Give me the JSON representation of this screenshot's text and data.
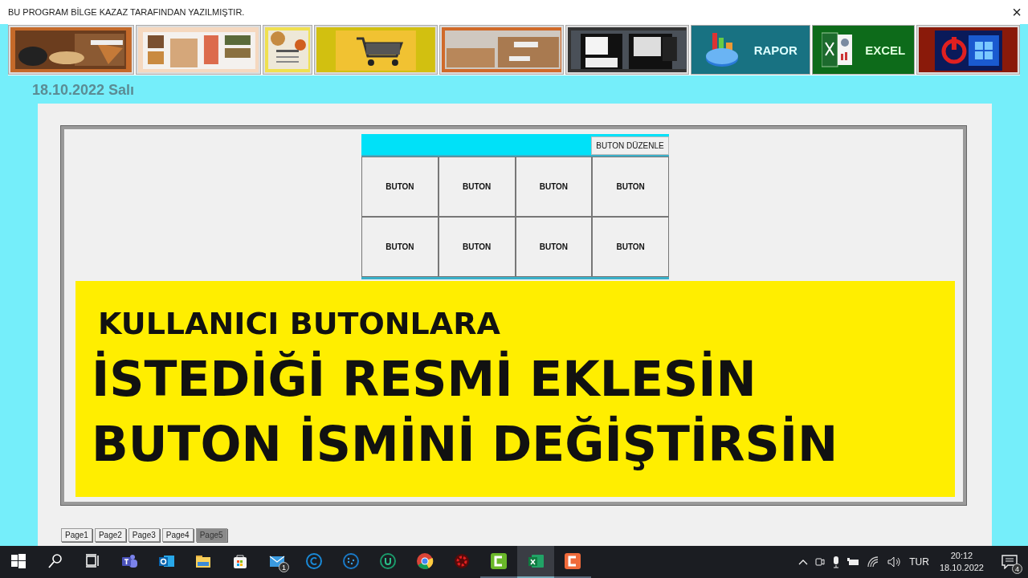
{
  "window": {
    "title": "BU PROGRAM BİLGE KAZAZ TARAFINDAN YAZILMIŞTIR.",
    "close": "×"
  },
  "toolbar": [
    {
      "kind": "picture"
    },
    {
      "kind": "picture"
    },
    {
      "kind": "picture"
    },
    {
      "kind": "picture"
    },
    {
      "kind": "picture"
    },
    {
      "kind": "picture"
    },
    {
      "kind": "report",
      "label": "RAPOR"
    },
    {
      "kind": "excel",
      "label": "EXCEL"
    },
    {
      "kind": "picture"
    }
  ],
  "date": "18.10.2022 Salı",
  "panel": {
    "edit_button": "BUTON DÜZENLE",
    "buttons": [
      "BUTON",
      "BUTON",
      "BUTON",
      "BUTON",
      "BUTON",
      "BUTON",
      "BUTON",
      "BUTON"
    ],
    "banner": [
      "KULLANICI BUTONLARA",
      "İSTEDİĞİ RESMİ EKLESİN",
      "BUTON İSMİNİ DEĞİŞTİRSİN"
    ]
  },
  "tabs": [
    {
      "label": "Page1",
      "selected": false
    },
    {
      "label": "Page2",
      "selected": false
    },
    {
      "label": "Page3",
      "selected": false
    },
    {
      "label": "Page4",
      "selected": false
    },
    {
      "label": "Page5",
      "selected": true
    }
  ],
  "taskbar": {
    "apps": [
      {
        "kind": "start"
      },
      {
        "kind": "search"
      },
      {
        "kind": "taskview"
      },
      {
        "kind": "teams"
      },
      {
        "kind": "outlook"
      },
      {
        "kind": "folder"
      },
      {
        "kind": "store"
      },
      {
        "kind": "mail",
        "badge": "1"
      },
      {
        "kind": "ring-c"
      },
      {
        "kind": "ring-dots"
      },
      {
        "kind": "ring-u"
      },
      {
        "kind": "chrome"
      },
      {
        "kind": "red-app"
      },
      {
        "kind": "camtasia-green",
        "selected": false
      },
      {
        "kind": "excel",
        "selected": true
      },
      {
        "kind": "camtasia",
        "selected": false
      }
    ],
    "language": "TUR",
    "time": "20:12",
    "date": "18.10.2022",
    "notifications": "4"
  }
}
